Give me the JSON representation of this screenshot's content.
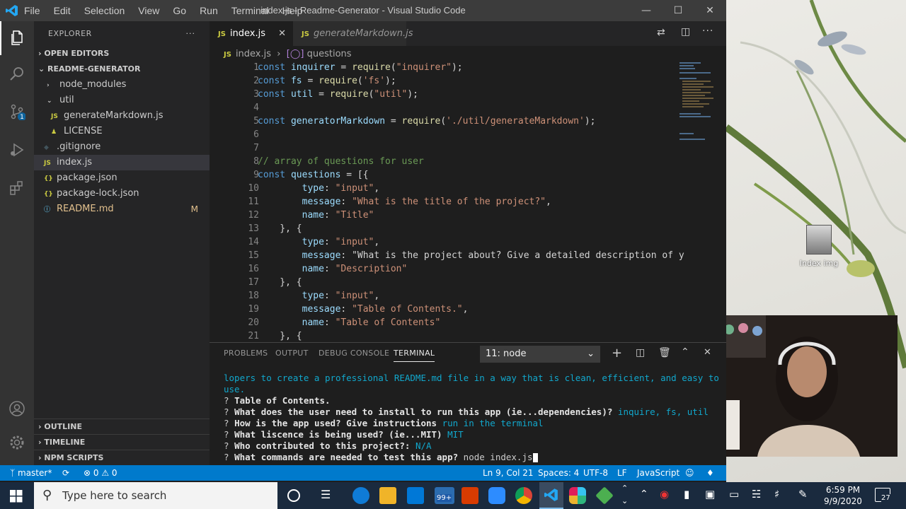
{
  "window": {
    "title": "index.js - Readme-Generator - Visual Studio Code",
    "menu": [
      "File",
      "Edit",
      "Selection",
      "View",
      "Go",
      "Run",
      "Terminal",
      "Help"
    ]
  },
  "sidebar": {
    "header": "EXPLORER",
    "open_editors": "OPEN EDITORS",
    "project": "README-GENERATOR",
    "items": [
      {
        "label": "node_modules",
        "kind": "folder-closed"
      },
      {
        "label": "util",
        "kind": "folder-open"
      },
      {
        "label": "generateMarkdown.js",
        "kind": "js"
      },
      {
        "label": "LICENSE",
        "kind": "license"
      },
      {
        "label": ".gitignore",
        "kind": "git"
      },
      {
        "label": "index.js",
        "kind": "js"
      },
      {
        "label": "package.json",
        "kind": "json"
      },
      {
        "label": "package-lock.json",
        "kind": "json"
      },
      {
        "label": "README.md",
        "kind": "info",
        "badge": "M"
      }
    ],
    "outline": "OUTLINE",
    "timeline": "TIMELINE",
    "npm_scripts": "NPM SCRIPTS"
  },
  "tabs": [
    {
      "label": "index.js",
      "badge": "JS"
    },
    {
      "label": "generateMarkdown.js",
      "badge": "JS"
    }
  ],
  "breadcrumbs": {
    "file": "index.js",
    "symbol": "questions"
  },
  "editor": {
    "lines": [
      {
        "n": "1",
        "text": "const inquirer = require(\"inquirer\");"
      },
      {
        "n": "2",
        "text": "const fs = require('fs');"
      },
      {
        "n": "3",
        "text": "const util = require(\"util\");"
      },
      {
        "n": "4",
        "text": ""
      },
      {
        "n": "5",
        "text": "const generatorMarkdown = require('./util/generateMarkdown');"
      },
      {
        "n": "6",
        "text": ""
      },
      {
        "n": "7",
        "text": ""
      },
      {
        "n": "8",
        "text": "// array of questions for user"
      },
      {
        "n": "9",
        "text": "const questions = [{"
      },
      {
        "n": "10",
        "text": "        type: \"input\","
      },
      {
        "n": "11",
        "text": "        message: \"What is the title of the project?\","
      },
      {
        "n": "12",
        "text": "        name: \"Title\""
      },
      {
        "n": "13",
        "text": "    }, {"
      },
      {
        "n": "14",
        "text": "        type: \"input\","
      },
      {
        "n": "15",
        "text": "        message: \"What is the project about? Give a detailed description of y"
      },
      {
        "n": "16",
        "text": "        name: \"Description\""
      },
      {
        "n": "17",
        "text": "    }, {"
      },
      {
        "n": "18",
        "text": "        type: \"input\","
      },
      {
        "n": "19",
        "text": "        message: \"Table of Contents.\","
      },
      {
        "n": "20",
        "text": "        name: \"Table of Contents\""
      },
      {
        "n": "21",
        "text": "    }, {"
      }
    ]
  },
  "panel": {
    "tabs": [
      "PROBLEMS",
      "OUTPUT",
      "DEBUG CONSOLE",
      "TERMINAL"
    ],
    "terminal_select": "11: node",
    "lines": [
      {
        "q": "",
        "text": "lopers to create a professional README.md file in a way that is clean, efficient, and easy to",
        "ans": ""
      },
      {
        "q": "",
        "text": "use.",
        "ans": ""
      },
      {
        "q": "? ",
        "text": "Table of Contents.",
        "ans": ""
      },
      {
        "q": "? ",
        "text": "What does the user need to install to run this app (ie...dependencies)?",
        "ans": " inquire, fs, util"
      },
      {
        "q": "? ",
        "text": "How is the app used? Give instructions",
        "ans": " run in the terminal"
      },
      {
        "q": "? ",
        "text": "What liscence is being used? (ie...MIT)",
        "ans": " MIT"
      },
      {
        "q": "? ",
        "text": "Who contributed to this project?:",
        "ans": " N/A"
      },
      {
        "q": "? ",
        "text": "What commands are needed to test this app?",
        "ans": " node index.js"
      }
    ]
  },
  "statusbar": {
    "branch": "master*",
    "problems": "⊗ 0 ⚠ 0",
    "position": "Ln 9, Col 21",
    "spaces": "Spaces: 4",
    "encoding": "UTF-8",
    "eol": "LF",
    "language": "JavaScript"
  },
  "desktop": {
    "icon_label": "Index img"
  },
  "taskbar": {
    "search_placeholder": "Type here to search",
    "badge": "99+",
    "time": "6:59 PM",
    "date": "9/9/2020",
    "notifications": "27"
  }
}
